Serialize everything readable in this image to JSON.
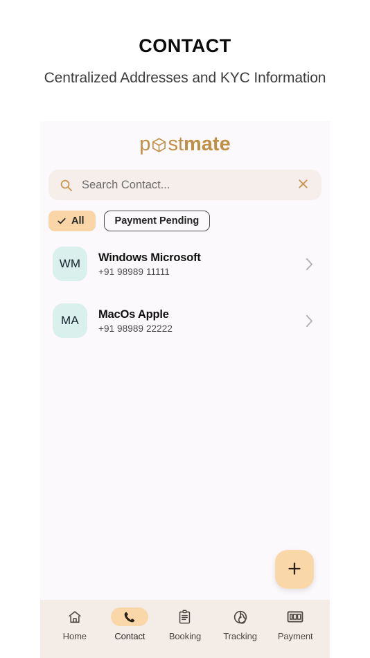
{
  "page": {
    "title": "CONTACT",
    "subtitle": "Centralized Addresses and KYC Information"
  },
  "brand": {
    "part1": "p",
    "cube_icon": "box-cube-icon",
    "part2": "st",
    "part3": "mate",
    "color": "#c08f46"
  },
  "search": {
    "placeholder": "Search Contact...",
    "value": "",
    "icon": "search-icon",
    "clear_icon": "close-x-icon",
    "clear_color": "#c9964f"
  },
  "filters": {
    "chips": [
      {
        "label": "All",
        "active": true,
        "icon": "check-icon"
      },
      {
        "label": "Payment Pending",
        "active": false,
        "icon": ""
      }
    ],
    "active_color": "#f9d5a8"
  },
  "contacts": [
    {
      "initials": "WM",
      "name": "Windows Microsoft",
      "phone": "+91 98989 11111",
      "avatar_color": "#d9f0ec",
      "chevron": "chevron-right-icon"
    },
    {
      "initials": "MA",
      "name": "MacOs Apple",
      "phone": "+91 98989 22222",
      "avatar_color": "#d9f0ec",
      "chevron": "chevron-right-icon"
    }
  ],
  "fab": {
    "label": "+",
    "icon": "plus-icon",
    "color": "#fad7a9"
  },
  "bottom_nav": {
    "items": [
      {
        "label": "Home",
        "icon": "home-icon",
        "active": false
      },
      {
        "label": "Contact",
        "icon": "phone-icon",
        "active": true
      },
      {
        "label": "Booking",
        "icon": "clipboard-icon",
        "active": false
      },
      {
        "label": "Tracking",
        "icon": "radar-icon",
        "active": false
      },
      {
        "label": "Payment",
        "icon": "banknote-icon",
        "active": false
      }
    ],
    "background": "#f3ece7",
    "active_pill_color": "#fad7a9"
  }
}
